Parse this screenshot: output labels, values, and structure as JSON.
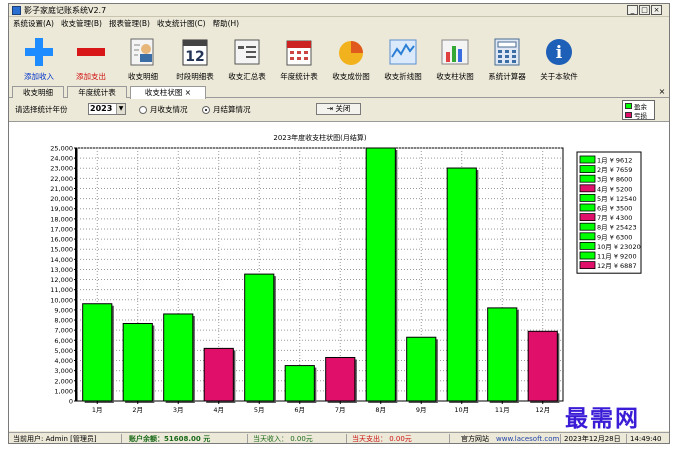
{
  "window": {
    "title": "影子家庭记账系统V2.7"
  },
  "menu": [
    "系统设置(A)",
    "收支管理(B)",
    "报表管理(B)",
    "收支统计图(C)",
    "帮助(H)"
  ],
  "toolbar": [
    {
      "label": "添加收入",
      "icon": "add-income-icon",
      "color": "#1e8cff",
      "style": "blue"
    },
    {
      "label": "添加支出",
      "icon": "add-expense-icon",
      "color": "#d81818",
      "style": "red"
    },
    {
      "label": "收支明细",
      "icon": "income-detail-icon",
      "color": "#3a6ea5",
      "style": ""
    },
    {
      "label": "时段明细表",
      "icon": "calendar-12-icon",
      "color": "#223355",
      "style": "",
      "text": "12"
    },
    {
      "label": "收支汇总表",
      "icon": "summary-report-icon",
      "color": "#4d4d4d",
      "style": ""
    },
    {
      "label": "年度统计表",
      "icon": "annual-calendar-icon",
      "color": "#cc2222",
      "style": ""
    },
    {
      "label": "收支成份图",
      "icon": "pie-chart-icon",
      "color": "#f2b21e",
      "style": ""
    },
    {
      "label": "收支折线图",
      "icon": "line-chart-icon",
      "color": "#2b7fd4",
      "style": ""
    },
    {
      "label": "收支柱状图",
      "icon": "bar-chart-icon",
      "color": "#35a835",
      "style": ""
    },
    {
      "label": "系统计算器",
      "icon": "calculator-icon",
      "color": "#3a6ea5",
      "style": ""
    },
    {
      "label": "关于本软件",
      "icon": "info-icon",
      "color": "#1e5fb8",
      "style": "",
      "text": "i"
    }
  ],
  "tabs": [
    {
      "label": "收支明细",
      "active": false
    },
    {
      "label": "年度统计表",
      "active": false
    },
    {
      "label": "收支柱状图",
      "active": true
    }
  ],
  "filter": {
    "year_label": "请选择统计年份",
    "year_value": "2023",
    "radio_monthly": "月收支情况",
    "radio_settled": "月结算情况",
    "close_label": "关闭",
    "legend_surplus": "盈余",
    "legend_deficit": "亏损"
  },
  "colors": {
    "surplus": "#00ff00",
    "deficit": "#e0106a"
  },
  "chart_data": {
    "type": "bar",
    "title": "2023年度收支柱状图(月结算)",
    "categories": [
      "1月",
      "2月",
      "3月",
      "4月",
      "5月",
      "6月",
      "7月",
      "8月",
      "9月",
      "10月",
      "11月",
      "12月"
    ],
    "values": [
      9612,
      7659,
      8600,
      5200,
      12540,
      3500,
      4300,
      25423,
      6300,
      23020,
      9200,
      6887
    ],
    "status": [
      "surplus",
      "surplus",
      "surplus",
      "deficit",
      "surplus",
      "surplus",
      "deficit",
      "surplus",
      "surplus",
      "surplus",
      "surplus",
      "deficit"
    ],
    "legend": [
      "1月 ¥ 9612",
      "2月 ¥ 7659",
      "3月 ¥ 8600",
      "4月 ¥ 5200",
      "5月 ¥ 12540",
      "6月 ¥ 3500",
      "7月 ¥ 4300",
      "8月 ¥ 25423",
      "9月 ¥ 6300",
      "10月 ¥ 23020",
      "11月 ¥ 9200",
      "12月 ¥ 6887"
    ],
    "ylim": [
      0,
      25000
    ],
    "yticks": [
      "0",
      "1,000",
      "2,000",
      "3,000",
      "4,000",
      "5,000",
      "6,000",
      "7,000",
      "8,000",
      "9,000",
      "10,000",
      "11,000",
      "12,000",
      "13,000",
      "14,000",
      "15,000",
      "16,000",
      "17,000",
      "18,000",
      "19,000",
      "20,000",
      "21,000",
      "22,000",
      "23,000",
      "24,000",
      "25,000"
    ],
    "grid": true,
    "legend_placement": "right"
  },
  "status": {
    "user": "当前用户: Admin [管理员]",
    "balance": "账户余额：51608.00 元",
    "income_today": "当天收入： 0.00元",
    "expense_today": "当天支出： 0.00元",
    "site_label": "官方网站",
    "site_url": "www.lacesoft.com",
    "date": "2023年12月28日",
    "time": "14:49:40"
  },
  "watermark": "最需网"
}
